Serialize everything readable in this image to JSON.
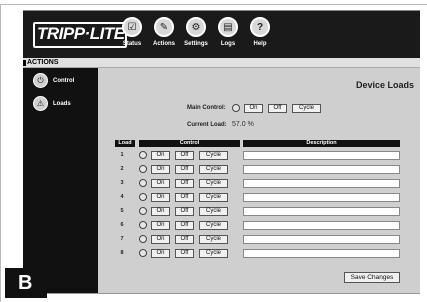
{
  "header": {
    "logo_text": "TRIPP·LITE",
    "nav": [
      {
        "label": "Status",
        "icon": "checkbox-icon",
        "glyph": "☑"
      },
      {
        "label": "Actions",
        "icon": "wrench-icon",
        "glyph": "✎"
      },
      {
        "label": "Settings",
        "icon": "gear-icon",
        "glyph": "⚙"
      },
      {
        "label": "Logs",
        "icon": "document-icon",
        "glyph": "▤"
      },
      {
        "label": "Help",
        "icon": "help-icon",
        "glyph": "?"
      }
    ]
  },
  "actions_section": {
    "label": "ACTIONS"
  },
  "sidebar": {
    "items": [
      {
        "label": "Control",
        "icon": "power-icon",
        "glyph": "⏻"
      },
      {
        "label": "Loads",
        "icon": "loads-icon",
        "glyph": "⚠"
      }
    ]
  },
  "main": {
    "title": "Device Loads",
    "main_control_label": "Main Control:",
    "current_load_label": "Current Load:",
    "current_load_value": "57.0 %",
    "buttons": {
      "on": "On",
      "off": "Off",
      "cycle": "Cycle"
    },
    "table": {
      "headers": {
        "load": "Load",
        "control": "Control",
        "description": "Description"
      },
      "rows": [
        {
          "num": "1",
          "description": ""
        },
        {
          "num": "2",
          "description": ""
        },
        {
          "num": "3",
          "description": ""
        },
        {
          "num": "4",
          "description": ""
        },
        {
          "num": "5",
          "description": ""
        },
        {
          "num": "6",
          "description": ""
        },
        {
          "num": "7",
          "description": ""
        },
        {
          "num": "8",
          "description": ""
        }
      ]
    },
    "save_label": "Save Changes"
  },
  "badge": {
    "text": "B"
  },
  "colors": {
    "header_bg": "#1a1a1a",
    "sidebar_bg": "#111111",
    "main_bg": "#cfcfcf"
  }
}
